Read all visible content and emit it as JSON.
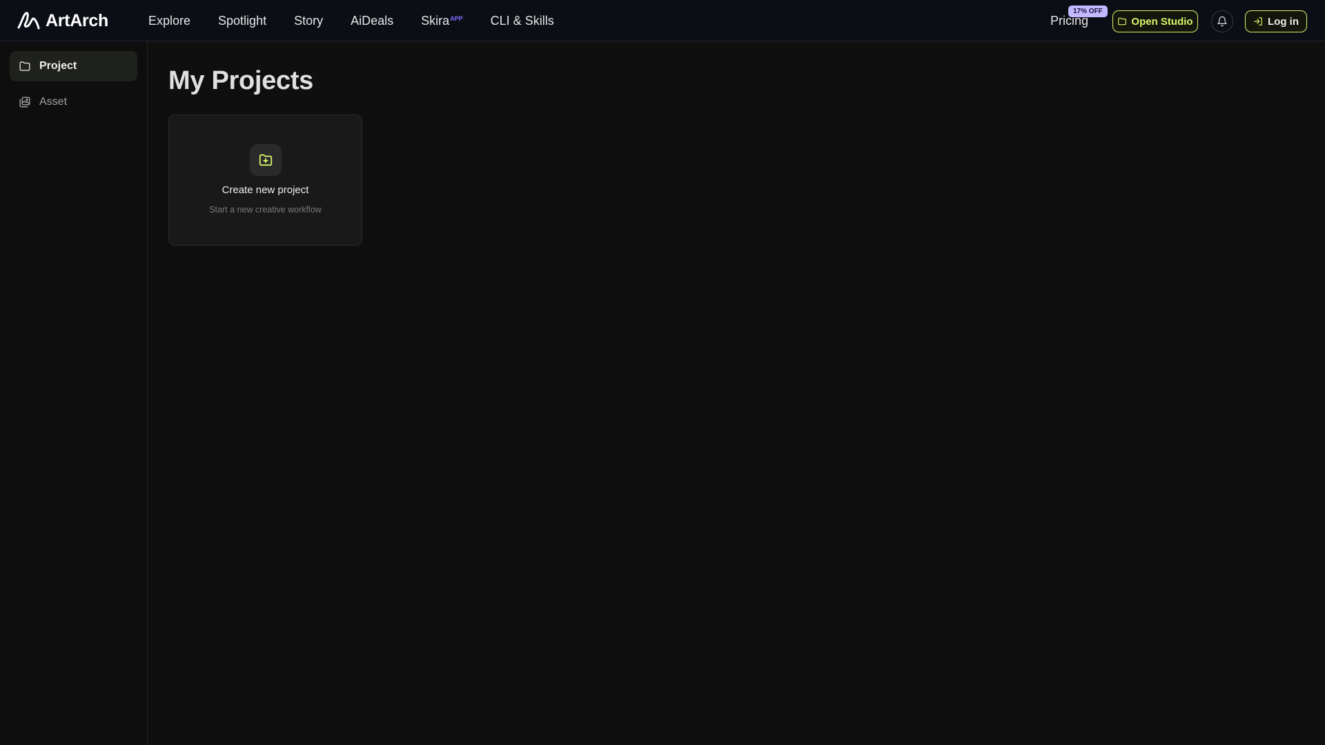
{
  "header": {
    "brand": "ArtArch",
    "nav": [
      {
        "label": "Explore"
      },
      {
        "label": "Spotlight"
      },
      {
        "label": "Story"
      },
      {
        "label": "AiDeals"
      },
      {
        "label": "Skira",
        "badge": "APP"
      },
      {
        "label": "CLI & Skills"
      }
    ],
    "pricing_label": "Pricing",
    "discount_badge": "17% OFF",
    "open_studio_label": "Open Studio",
    "login_label": "Log in"
  },
  "sidebar": {
    "items": [
      {
        "label": "Project",
        "icon": "folder-icon",
        "active": true
      },
      {
        "label": "Asset",
        "icon": "image-stack-icon",
        "active": false
      }
    ]
  },
  "main": {
    "title": "My Projects",
    "create_card": {
      "icon": "folder-plus-icon",
      "title": "Create new project",
      "subtitle": "Start a new creative workflow"
    }
  },
  "colors": {
    "accent": "#d6f36b",
    "background": "#0f0f0f",
    "header_bg": "#0c0e16",
    "badge_bg": "#c4b8ff",
    "app_superscript": "#7b6cff"
  }
}
